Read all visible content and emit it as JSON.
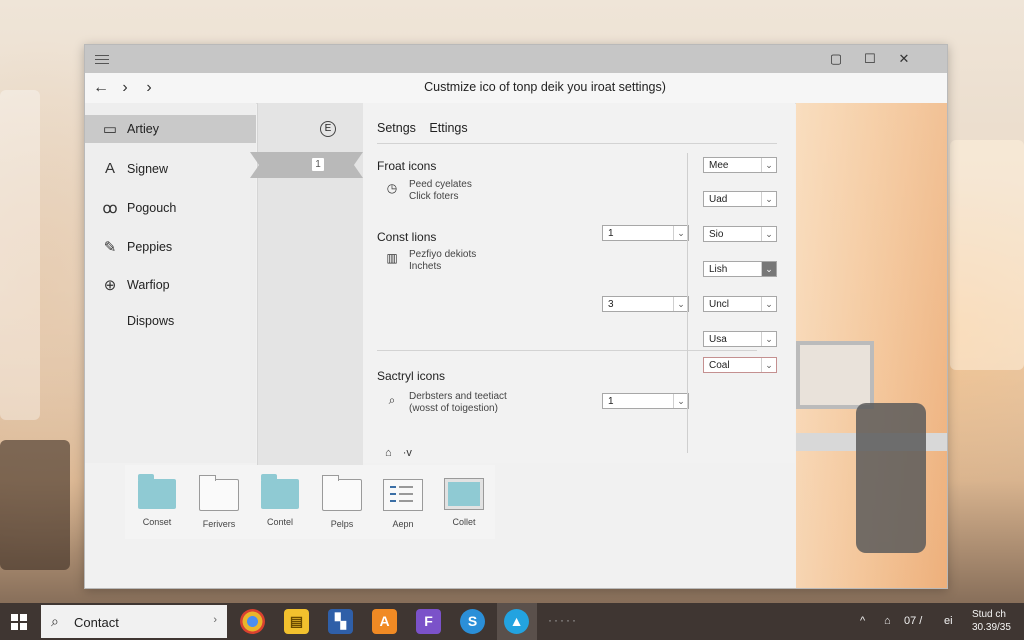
{
  "window": {
    "title": "Custmize ico of tonp deik you iroat settings)",
    "controls": {
      "restore": "▢",
      "maximize": "☐",
      "close": "✕"
    }
  },
  "nav": {
    "back": "←",
    "forward": "›",
    "forward2": "›"
  },
  "sidebar": {
    "items": [
      {
        "icon": "▭",
        "label": "Artiey"
      },
      {
        "icon": "A",
        "label": "Signew"
      },
      {
        "icon": "ꝏ",
        "label": "Pogouch"
      },
      {
        "icon": "✎",
        "label": "Peppies"
      },
      {
        "icon": "⊕",
        "label": "Warfiop"
      },
      {
        "icon": "",
        "label": "Dispows"
      }
    ]
  },
  "column2": {
    "top_icon": "E",
    "badge": "1"
  },
  "main": {
    "tabs": [
      "Setngs",
      "Ettings"
    ],
    "sections": [
      {
        "heading": "Froat icons",
        "icon": "◷",
        "desc1": "Peed cyelates",
        "desc2": "Click foters",
        "value": "1"
      },
      {
        "heading": "Const lions",
        "icon": "▥",
        "desc1": "Pezfiyo dekiots",
        "desc2": "Inchets",
        "value": "3"
      },
      {
        "heading": "Sactryl icons",
        "icon": "⌕",
        "desc1": "Derbsters and teetiact",
        "desc2": "(wosst of toigestion)",
        "value": "1"
      }
    ],
    "footer": {
      "icon": "⌂",
      "label": "·v"
    }
  },
  "right_selects": [
    "Mee",
    "Uad",
    "Sio",
    "Lish",
    "Uncl",
    "Usa",
    "Coal"
  ],
  "files": [
    {
      "label": "Conset"
    },
    {
      "label": "Ferivers"
    },
    {
      "label": "Contel"
    },
    {
      "label": "Pelps"
    },
    {
      "label": "Aepn"
    },
    {
      "label": "Collet"
    }
  ],
  "taskbar": {
    "search_text": "Contact",
    "tray": {
      "chevron": "^",
      "text1": "07 /",
      "text2": "ei"
    },
    "clock_line1": "Stud ch",
    "clock_line2": "30.39/35"
  }
}
